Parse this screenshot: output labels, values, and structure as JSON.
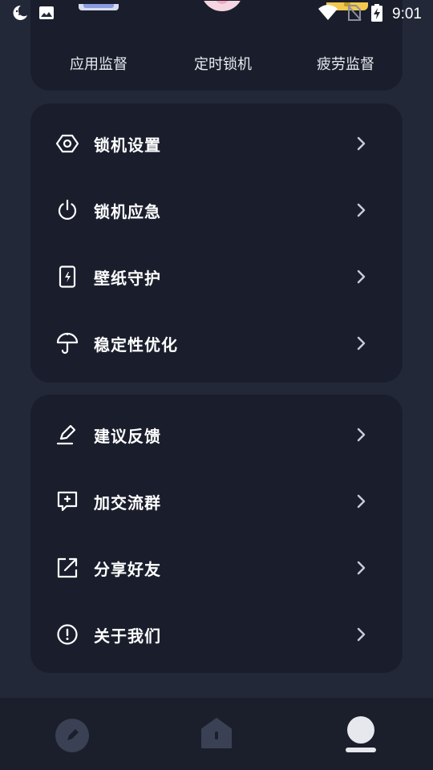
{
  "status_bar": {
    "time": "9:01",
    "icons": [
      "moon-icon",
      "image-icon",
      "wifi-icon",
      "no-sim-icon",
      "battery-charging-icon"
    ]
  },
  "quick_actions": [
    {
      "label": "应用监督",
      "icon": "app-monitor-icon",
      "accent": "#8a9be0"
    },
    {
      "label": "定时锁机",
      "icon": "timer-lock-icon",
      "accent": "#f5d6e0"
    },
    {
      "label": "疲劳监督",
      "icon": "fatigue-monitor-icon",
      "accent": "#f2c94c"
    }
  ],
  "settings_group": [
    {
      "label": "锁机设置",
      "icon": "hexagon-settings-icon"
    },
    {
      "label": "锁机应急",
      "icon": "power-icon"
    },
    {
      "label": "壁纸守护",
      "icon": "phone-charge-icon"
    },
    {
      "label": "稳定性优化",
      "icon": "umbrella-icon"
    }
  ],
  "more_group": [
    {
      "label": "建议反馈",
      "icon": "pencil-icon"
    },
    {
      "label": "加交流群",
      "icon": "chat-plus-icon"
    },
    {
      "label": "分享好友",
      "icon": "share-external-icon"
    },
    {
      "label": "关于我们",
      "icon": "info-exclamation-icon"
    }
  ],
  "bottom_nav": [
    {
      "name": "nav-edit",
      "icon": "edit-circle-icon",
      "active": false
    },
    {
      "name": "nav-home",
      "icon": "home-icon",
      "active": false
    },
    {
      "name": "nav-profile",
      "icon": "profile-icon",
      "active": true
    }
  ],
  "colors": {
    "background": "#232838",
    "card": "#1a1e2c",
    "text": "#ffffff",
    "chevron": "#c9ccd6",
    "nav_inactive": "#3b4155",
    "nav_active": "#e6e8ee"
  }
}
